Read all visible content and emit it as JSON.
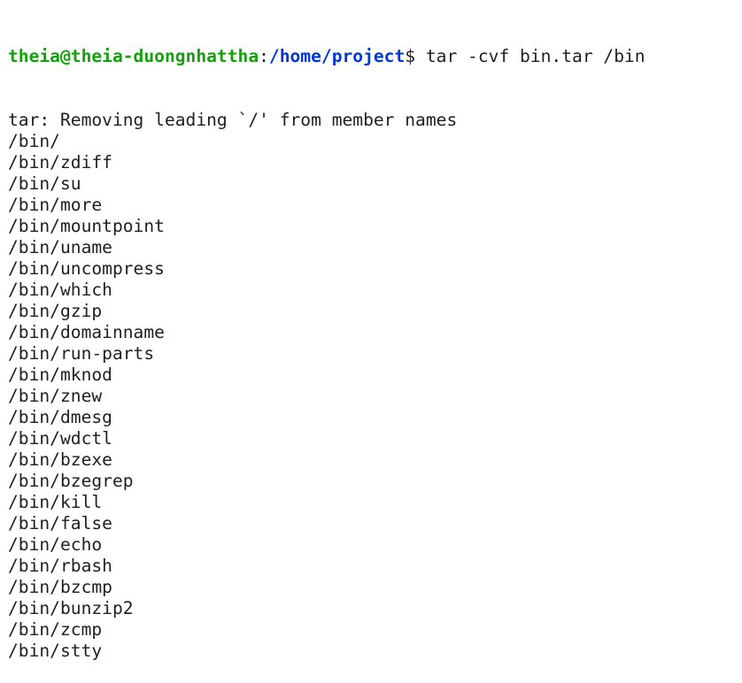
{
  "terminal": {
    "prompt": {
      "user_host": "theia@theia-duongnhattha",
      "separator": ":",
      "path": "/home/project",
      "symbol": "$",
      "command": " tar -cvf bin.tar /bin"
    },
    "output": [
      "tar: Removing leading `/' from member names",
      "/bin/",
      "/bin/zdiff",
      "/bin/su",
      "/bin/more",
      "/bin/mountpoint",
      "/bin/uname",
      "/bin/uncompress",
      "/bin/which",
      "/bin/gzip",
      "/bin/domainname",
      "/bin/run-parts",
      "/bin/mknod",
      "/bin/znew",
      "/bin/dmesg",
      "/bin/wdctl",
      "/bin/bzexe",
      "/bin/bzegrep",
      "/bin/kill",
      "/bin/false",
      "/bin/echo",
      "/bin/rbash",
      "/bin/bzcmp",
      "/bin/bunzip2",
      "/bin/zcmp",
      "/bin/stty"
    ],
    "colors": {
      "user_host": "#13a10e",
      "path": "#0037da",
      "text": "#1f1f1f",
      "background": "#ffffff"
    }
  }
}
